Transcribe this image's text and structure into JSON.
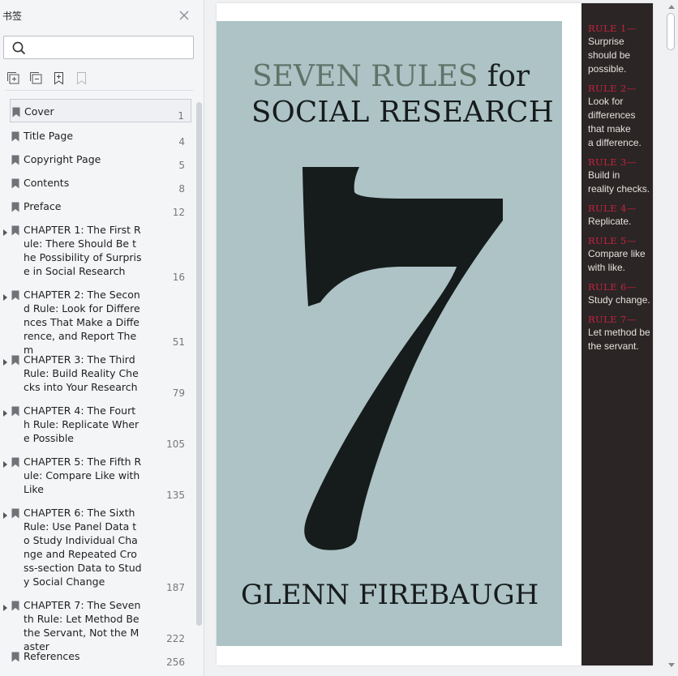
{
  "sidebar": {
    "title": "书签",
    "search": {
      "value": "",
      "placeholder": ""
    },
    "bookmarks": [
      {
        "label": "Cover",
        "page": "1"
      },
      {
        "label": "Title Page",
        "page": "4"
      },
      {
        "label": "Copyright Page",
        "page": "5"
      },
      {
        "label": "Contents",
        "page": "8"
      },
      {
        "label": "Preface",
        "page": "12"
      },
      {
        "label": "CHAPTER 1: The First Rule: There Should Be the Possibility of Surprise in Social Research",
        "page": "16"
      },
      {
        "label": "CHAPTER 2: The Second Rule: Look for Differences That Make a Difference, and Report Them",
        "page": "51"
      },
      {
        "label": "CHAPTER 3: The Third Rule: Build Reality Checks into Your Research",
        "page": "79"
      },
      {
        "label": "CHAPTER 4: The Fourth Rule: Replicate Where Possible",
        "page": "105"
      },
      {
        "label": "CHAPTER 5: The Fifth Rule: Compare Like with Like",
        "page": "135"
      },
      {
        "label": "CHAPTER 6: The Sixth Rule: Use Panel Data to Study Individual Change and Repeated Cross-section Data to Study Social Change",
        "page": "187"
      },
      {
        "label": "CHAPTER 7: The Seventh Rule: Let Method Be the Servant, Not the Master",
        "page": "222"
      },
      {
        "label": "References",
        "page": "256"
      }
    ]
  },
  "cover": {
    "title_part1": "SEVEN RULES",
    "title_part2": " for",
    "title_line2": "SOCIAL RESEARCH",
    "author": "GLENN FIREBAUGH",
    "colors": {
      "background": "#adc3c5",
      "accent": "#5f7469",
      "ink": "#161b1c"
    }
  },
  "spine": {
    "rules": [
      {
        "title": "RULE 1—",
        "text": [
          "Surprise",
          "should be",
          "possible."
        ]
      },
      {
        "title": "RULE 2—",
        "text": [
          "Look for",
          "differences",
          "that make",
          "a difference."
        ]
      },
      {
        "title": "RULE 3—",
        "text": [
          "Build in",
          "reality checks."
        ]
      },
      {
        "title": "RULE 4—",
        "text": [
          "Replicate."
        ]
      },
      {
        "title": "RULE 5—",
        "text": [
          "Compare like",
          "with like."
        ]
      },
      {
        "title": "RULE 6—",
        "text": [
          "Study change."
        ]
      },
      {
        "title": "RULE 7—",
        "text": [
          "Let method be",
          "the servant."
        ]
      }
    ],
    "colors": {
      "background": "#2b2526",
      "rule": "#c4253a",
      "text": "#e6e1dc"
    }
  }
}
